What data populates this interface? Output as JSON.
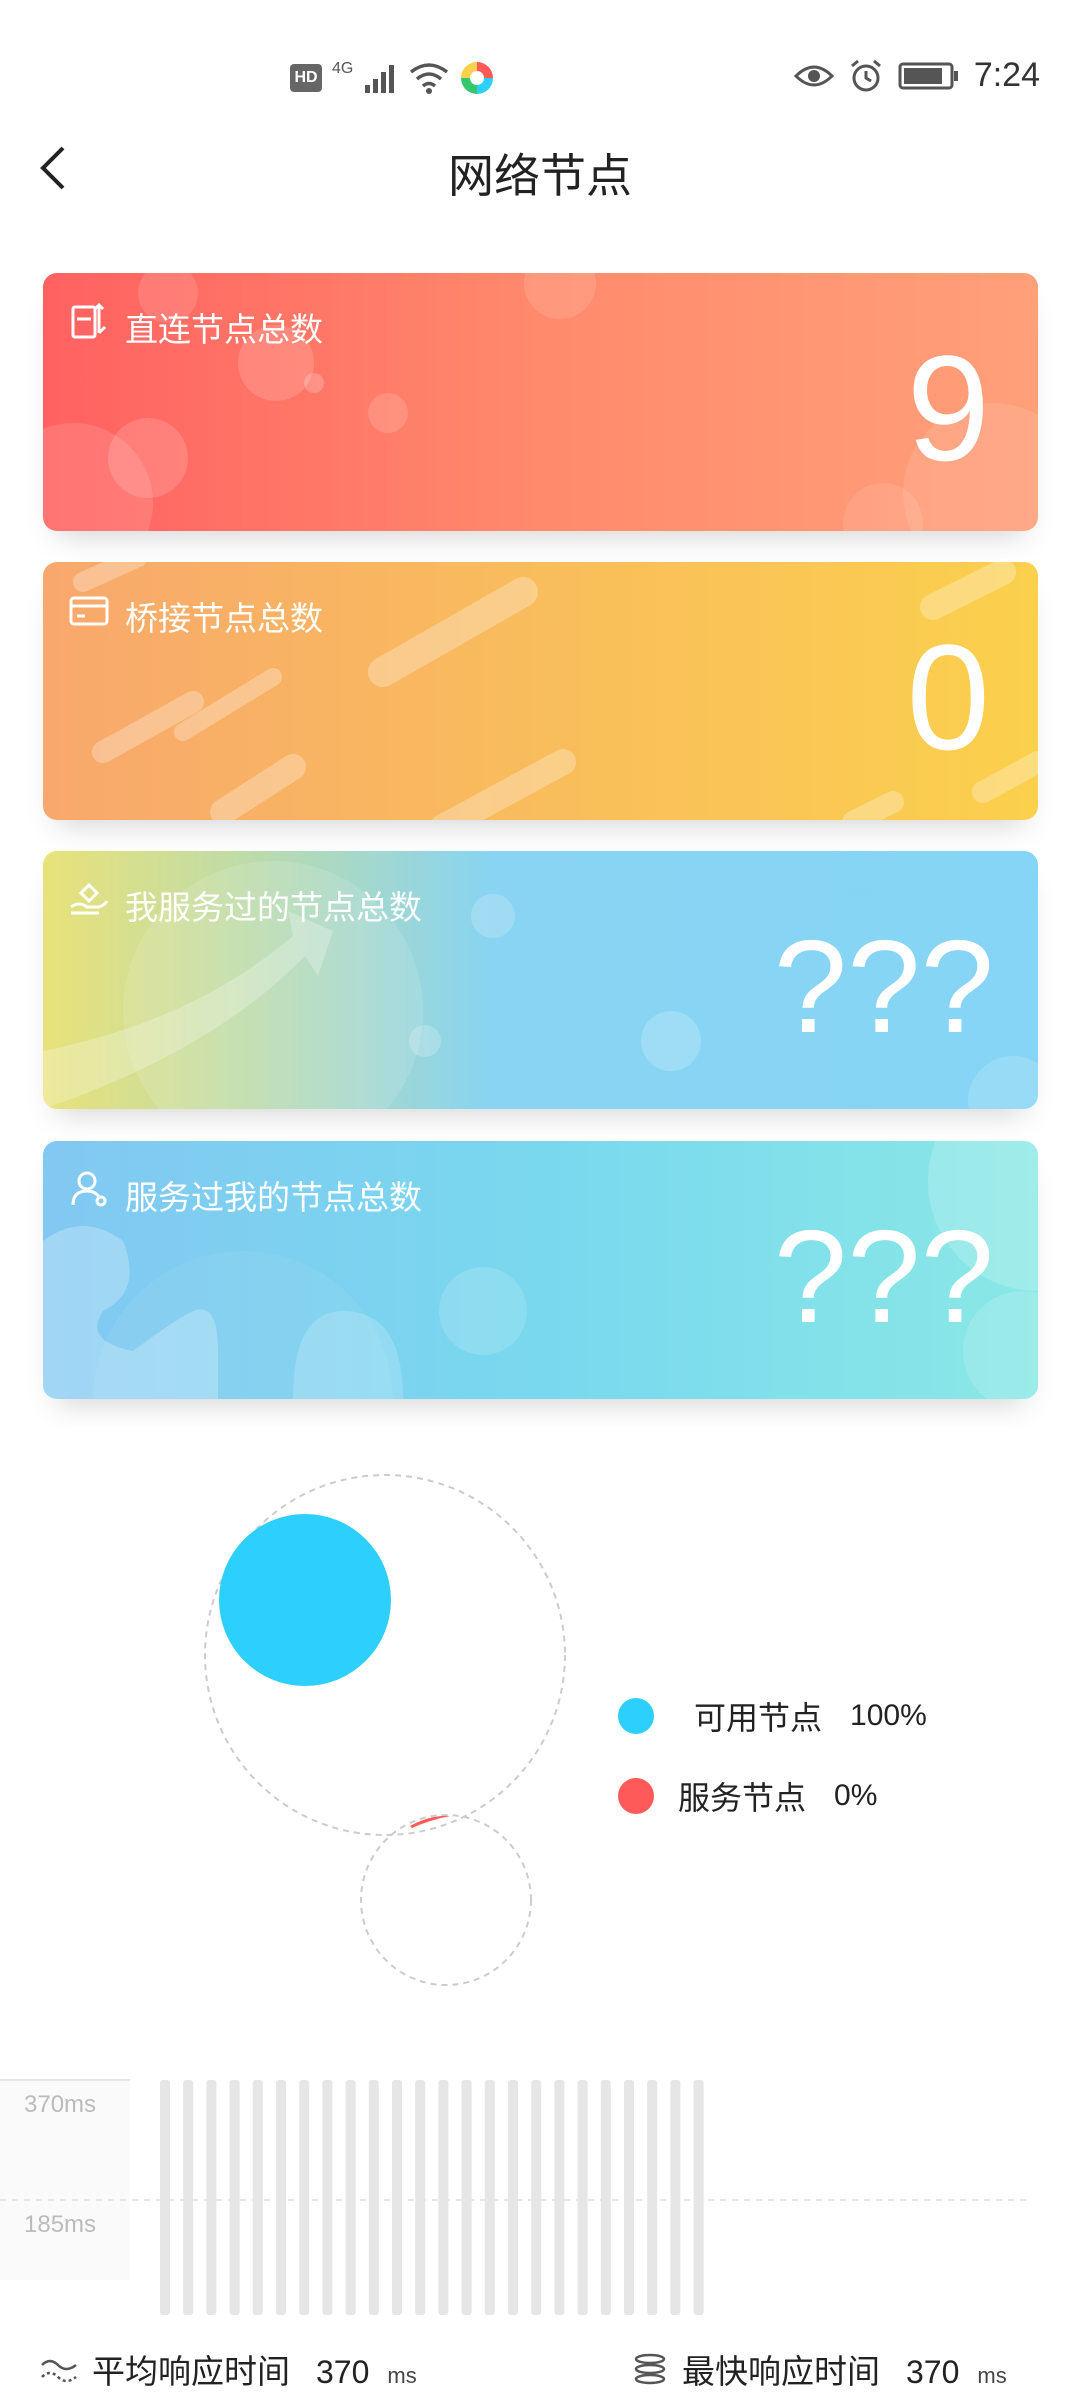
{
  "status_bar": {
    "hd": "HD",
    "network": "4G",
    "time": "7:24"
  },
  "header": {
    "title": "网络节点"
  },
  "cards": [
    {
      "label": "直连节点总数",
      "value": "9",
      "icon": "direct-connect-icon",
      "color_start": "#ff6161",
      "color_end": "#ffa07a"
    },
    {
      "label": "桥接节点总数",
      "value": "0",
      "icon": "bridge-icon",
      "color_start": "#f8a86c",
      "color_end": "#fbd04d"
    },
    {
      "label": "我服务过的节点总数",
      "value": "???",
      "icon": "service-hand-icon",
      "color_start": "#e9e27a",
      "color_end": "#86d5f6"
    },
    {
      "label": "服务过我的节点总数",
      "value": "???",
      "icon": "user-icon",
      "color_start": "#82c8f2",
      "color_end": "#8ae8e6"
    }
  ],
  "legend": [
    {
      "label": "可用节点",
      "value": "100%",
      "color": "#2dcffd"
    },
    {
      "label": "服务节点",
      "value": "0%",
      "color": "#ff5a5a"
    }
  ],
  "bar_chart": {
    "y_ticks": [
      "370ms",
      "185ms"
    ],
    "bar_values_ms": [
      370,
      370,
      370,
      370,
      370,
      370,
      370,
      370,
      370,
      370,
      370,
      370,
      370,
      370,
      370,
      370,
      370,
      370,
      370,
      370,
      370,
      370,
      370,
      370
    ]
  },
  "footer": {
    "avg_label": "平均响应时间",
    "avg_value": "370",
    "avg_unit": "ms",
    "fast_label": "最快响应时间",
    "fast_value": "370",
    "fast_unit": "ms"
  }
}
